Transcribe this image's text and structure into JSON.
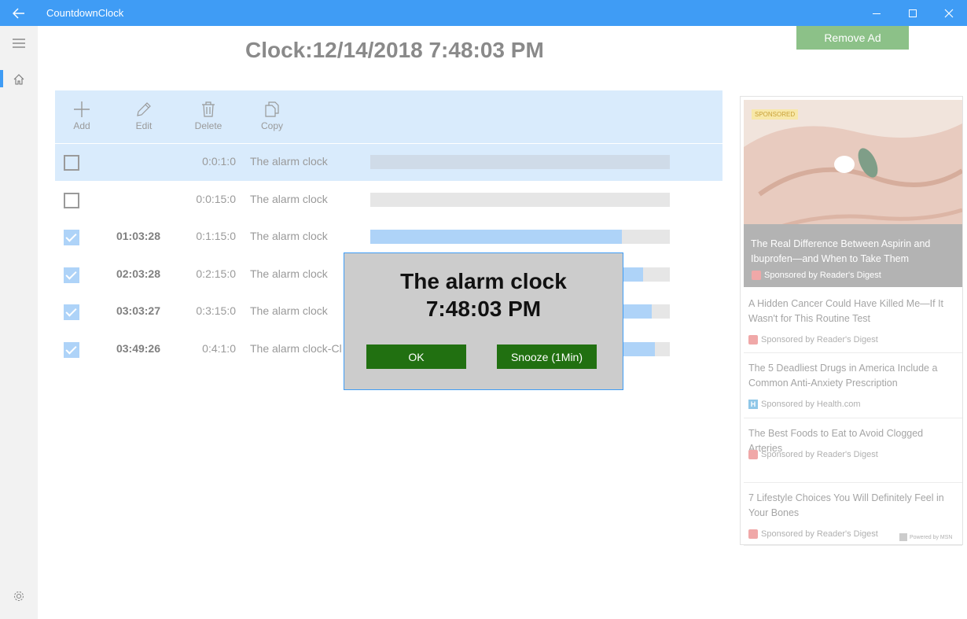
{
  "window": {
    "title": "CountdownClock",
    "back_icon": "back-arrow-icon",
    "accent": "#3f9cf5"
  },
  "header": {
    "clock": "Clock:12/14/2018 7:48:03 PM",
    "remove_ad": "Remove Ad"
  },
  "toolbar": {
    "add": "Add",
    "edit": "Edit",
    "delete": "Delete",
    "copy": "Copy"
  },
  "timers": [
    {
      "checked": false,
      "remaining": "",
      "duration": "0:0:1:0",
      "name": "The alarm clock",
      "progress": 0
    },
    {
      "checked": false,
      "remaining": "",
      "duration": "0:0:15:0",
      "name": "The alarm clock",
      "progress": 0
    },
    {
      "checked": true,
      "remaining": "01:03:28",
      "duration": "0:1:15:0",
      "name": "The alarm clock",
      "progress": 0.84
    },
    {
      "checked": true,
      "remaining": "02:03:28",
      "duration": "0:2:15:0",
      "name": "The alarm clock",
      "progress": 0.91
    },
    {
      "checked": true,
      "remaining": "03:03:27",
      "duration": "0:3:15:0",
      "name": "The alarm clock",
      "progress": 0.94
    },
    {
      "checked": true,
      "remaining": "03:49:26",
      "duration": "0:4:1:0",
      "name": "The alarm clock-Cl",
      "progress": 0.95
    }
  ],
  "dialog": {
    "title": "The alarm clock",
    "time": "7:48:03 PM",
    "ok": "OK",
    "snooze": "Snooze  (1Min)",
    "button_color": "#217011"
  },
  "ad": {
    "sponsored_tag": "SPONSORED",
    "hero": {
      "headline": "The Real Difference Between Aspirin and Ibuprofen—and When to Take Them",
      "sponsor": "Sponsored by Reader's Digest"
    },
    "items": [
      {
        "headline": "A Hidden Cancer Could Have Killed Me—If It Wasn't for This Routine Test",
        "sponsor": "Sponsored by Reader's Digest",
        "logo": "rd"
      },
      {
        "headline": "The 5 Deadliest Drugs in America Include a Common Anti-Anxiety Prescription",
        "sponsor": "Sponsored by Health.com",
        "logo": "h"
      },
      {
        "headline": "The Best Foods to Eat to Avoid Clogged Arteries",
        "sponsor": "Sponsored by Reader's Digest",
        "logo": "rd"
      },
      {
        "headline": "7 Lifestyle Choices You Will Definitely Feel in Your Bones",
        "sponsor": "Sponsored by Reader's Digest",
        "logo": "rd"
      }
    ],
    "powered": "Powered by MSN"
  }
}
